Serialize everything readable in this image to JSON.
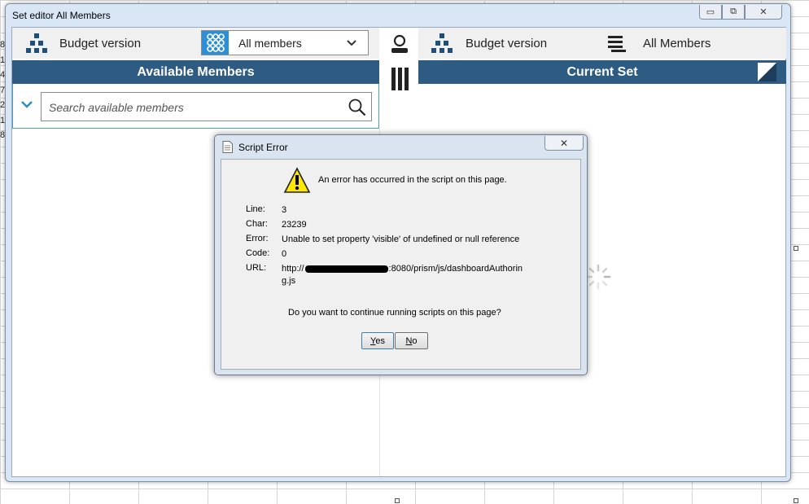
{
  "spreadsheet": {
    "row_fragments": [
      "8",
      "1",
      "4",
      "7",
      "2",
      "1",
      "8"
    ]
  },
  "window": {
    "title": "Set editor All Members",
    "controls": {
      "minimize": "▭",
      "restore": "⧉",
      "close": "✕"
    }
  },
  "left_panel": {
    "dimension_label": "Budget version",
    "dimension_icon": "hierarchy-icon",
    "member_select": {
      "value": "All members",
      "icon": "grid-members-icon"
    },
    "header": "Available Members",
    "search": {
      "placeholder": "Search available members",
      "value": ""
    }
  },
  "right_panel": {
    "dimension_label": "Budget version",
    "set_label": "All Members",
    "header": "Current Set"
  },
  "dialog": {
    "title": "Script Error",
    "close_label": "✕",
    "message": "An error has occurred in the script on this page.",
    "fields": [
      {
        "key": "Line:",
        "value": "3"
      },
      {
        "key": "Char:",
        "value": "23239"
      },
      {
        "key": "Error:",
        "value": "Unable to set property 'visible' of undefined or null reference"
      },
      {
        "key": "Code:",
        "value": "0"
      }
    ],
    "url": {
      "key": "URL:",
      "prefix": "http://",
      "suffix": ":8080/prism/js/dashboardAuthorin",
      "suffix2": "g.js"
    },
    "question": "Do you want to continue running scripts on this page?",
    "buttons": {
      "yes": {
        "accel": "Y",
        "rest": "es"
      },
      "no": {
        "accel": "N",
        "rest": "o"
      }
    }
  },
  "colors": {
    "header_bar": "#2e5b82",
    "accent_blue": "#2d8fd5",
    "search_border": "#43a1c8"
  }
}
